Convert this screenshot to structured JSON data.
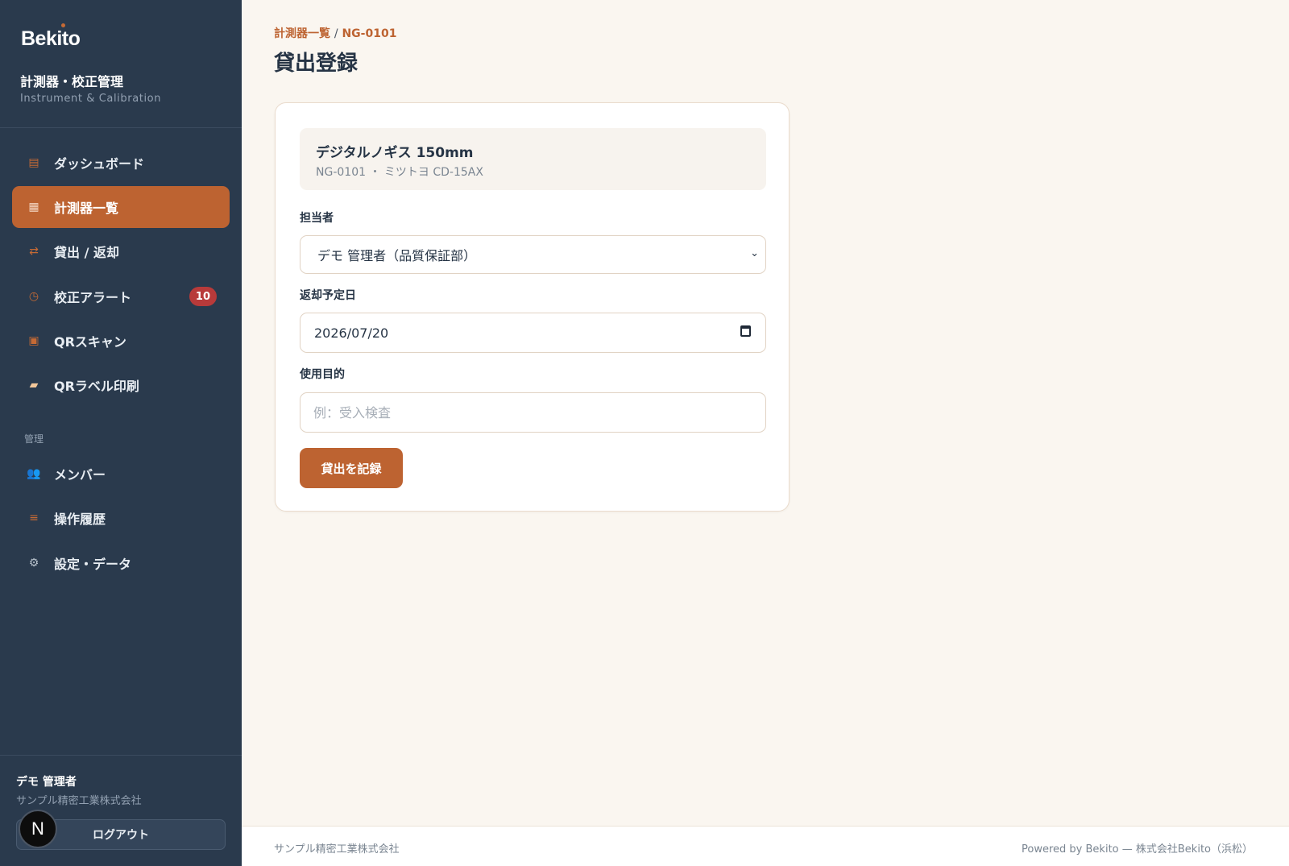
{
  "sidebar": {
    "brand": "Bekito",
    "app_title": "計測器・校正管理",
    "app_subtitle": "Instrument & Calibration",
    "nav": [
      {
        "label": "ダッシュボード",
        "icon": "dashboard-icon",
        "active": false
      },
      {
        "label": "計測器一覧",
        "icon": "grid-icon",
        "active": true
      },
      {
        "label": "貸出 / 返却",
        "icon": "swap-arrows-icon",
        "active": false
      },
      {
        "label": "校正アラート",
        "icon": "clock-icon",
        "active": false,
        "badge": "10"
      },
      {
        "label": "QRスキャン",
        "icon": "qr-scan-icon",
        "active": false
      },
      {
        "label": "QRラベル印刷",
        "icon": "label-tag-icon",
        "active": false
      }
    ],
    "section_label": "管理",
    "admin_nav": [
      {
        "label": "メンバー",
        "icon": "members-icon"
      },
      {
        "label": "操作履歴",
        "icon": "list-icon"
      },
      {
        "label": "設定・データ",
        "icon": "gear-icon"
      }
    ],
    "user": {
      "name": "デモ 管理者",
      "org": "サンプル精密工業株式会社",
      "avatar_letter": "N",
      "logout_label": "ログアウト"
    }
  },
  "header": {
    "breadcrumb_parent": "計測器一覧",
    "breadcrumb_sep": "/",
    "breadcrumb_current": "NG-0101",
    "title": "貸出登録"
  },
  "instrument": {
    "name": "デジタルノギス 150mm",
    "meta": "NG-0101 ・ ミツトヨ CD-15AX"
  },
  "form": {
    "assignee_label": "担当者",
    "assignee_value": "デモ 管理者（品質保証部）",
    "due_label": "返却予定日",
    "due_value": "2026/07/20",
    "purpose_label": "使用目的",
    "purpose_placeholder": "例：受入検査",
    "submit_label": "貸出を記録"
  },
  "footer": {
    "left": "サンプル精密工業株式会社",
    "right": "Powered by Bekito — 株式会社Bekito（浜松）"
  },
  "colors": {
    "accent": "#bd6331",
    "sidebar_bg": "#2a3a4d",
    "page_bg": "#faf6f0",
    "badge": "#b83a3a"
  }
}
